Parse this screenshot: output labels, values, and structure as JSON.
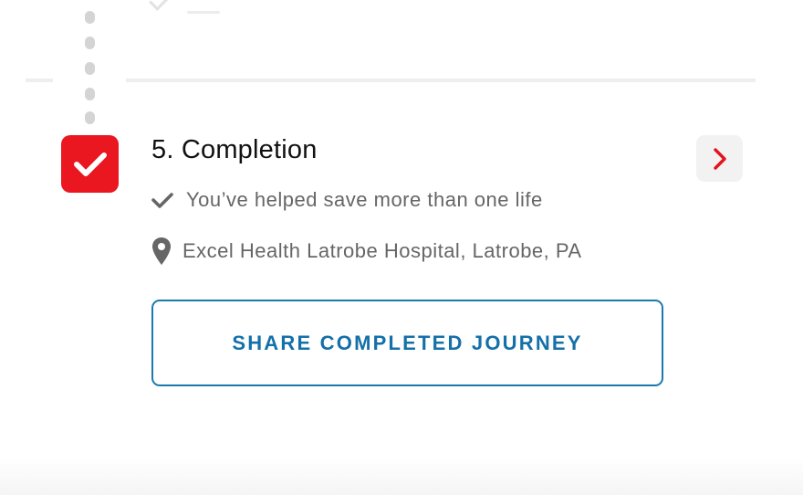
{
  "step": {
    "title": "5. Completion",
    "status": "completed",
    "accent_color": "#ea1620"
  },
  "details": {
    "message": "You’ve helped save more than one life",
    "message_icon": "checkmark-icon",
    "location": "Excel Health Latrobe Hospital, Latrobe, PA",
    "location_icon": "map-pin-icon"
  },
  "navigation": {
    "chevron_icon": "chevron-right-icon"
  },
  "actions": {
    "share_label": "SHARE COMPLETED JOURNEY",
    "share_color": "#1470a8"
  }
}
